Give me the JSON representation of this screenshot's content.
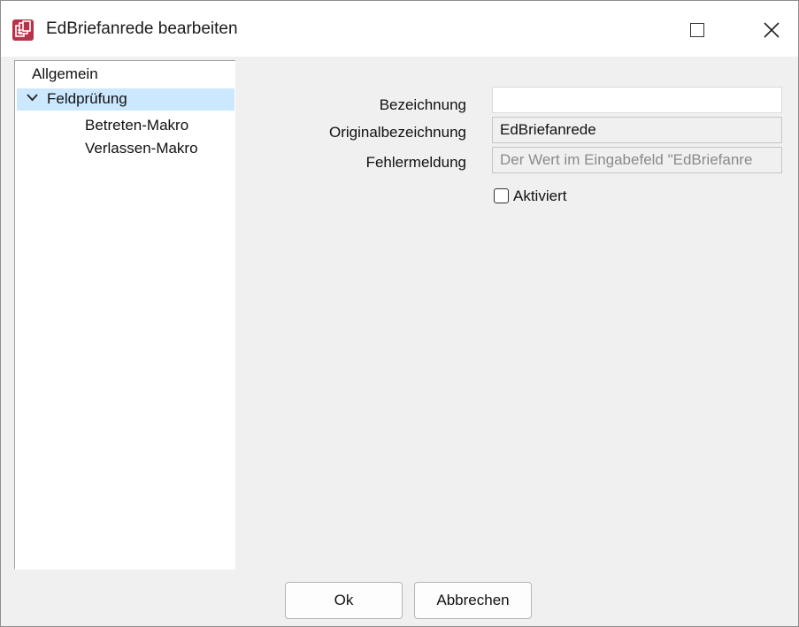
{
  "window": {
    "title": "EdBriefanrede bearbeiten",
    "icon": "document-app-icon",
    "controls": [
      "maximize",
      "close"
    ]
  },
  "tree": {
    "items": [
      {
        "label": "Allgemein",
        "level": 0,
        "selected": false
      },
      {
        "label": "Feldprüfung",
        "level": 0,
        "expanded": true,
        "selected": true
      },
      {
        "label": "Betreten-Makro",
        "level": 1,
        "selected": false
      },
      {
        "label": "Verlassen-Makro",
        "level": 1,
        "selected": false
      }
    ]
  },
  "form": {
    "bezeichnung": {
      "label": "Bezeichnung",
      "value": ""
    },
    "originalbezeichnung": {
      "label": "Originalbezeichnung",
      "value": "EdBriefanrede"
    },
    "fehlermeldung": {
      "label": "Fehlermeldung",
      "value": "Der Wert im Eingabefeld \"EdBriefanre"
    },
    "aktiviert": {
      "label": "Aktiviert",
      "checked": false
    }
  },
  "buttons": {
    "ok": "Ok",
    "cancel": "Abbrechen"
  },
  "colors": {
    "accent_icon": "#c0392b",
    "selection": "#cce8ff"
  }
}
